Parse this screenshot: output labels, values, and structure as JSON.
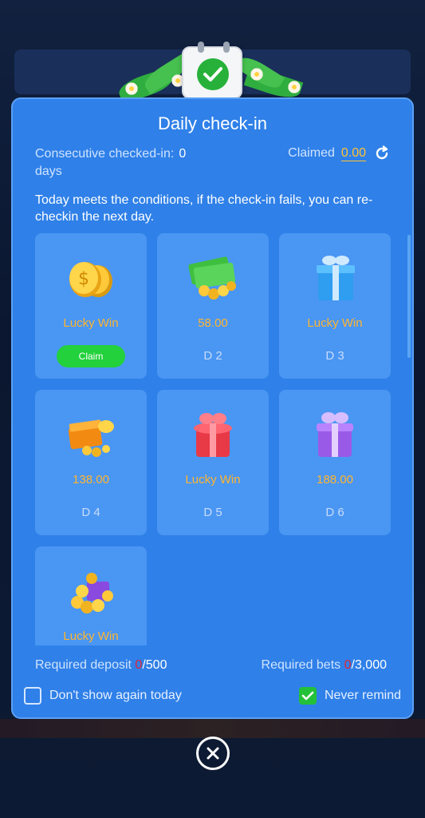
{
  "modal": {
    "title": "Daily check-in",
    "consecutive_label": "Consecutive checked-in:",
    "consecutive_value": "0",
    "consecutive_unit": "days",
    "claimed_label": "Claimed",
    "claimed_value": "0.00",
    "notice": "Today meets the conditions, if the check-in fails, you can re-checkin the next day."
  },
  "cards": [
    {
      "icon": "gold-coins-icon",
      "label": "Lucky Win",
      "day": "",
      "button": "Claim"
    },
    {
      "icon": "cash-and-coins-icon",
      "label": "58.00",
      "day": "D 2"
    },
    {
      "icon": "blue-gift-icon",
      "label": "Lucky Win",
      "day": "D 3"
    },
    {
      "icon": "orange-treasure-icon",
      "label": "138.00",
      "day": "D 4"
    },
    {
      "icon": "red-gift-icon",
      "label": "Lucky Win",
      "day": "D 5"
    },
    {
      "icon": "purple-gift-icon",
      "label": "188.00",
      "day": "D 6"
    },
    {
      "icon": "coin-pile-icon",
      "label": "Lucky Win",
      "day": ""
    }
  ],
  "requirements": {
    "deposit_label": "Required deposit",
    "deposit_current": "0",
    "deposit_total": "/500",
    "bets_label": "Required bets",
    "bets_current": "0",
    "bets_total": "/3,000"
  },
  "options": {
    "dont_show": "Don't show again today",
    "dont_show_checked": false,
    "never_remind": "Never remind",
    "never_remind_checked": true
  },
  "colors": {
    "modal_bg": "#2f80e8",
    "card_bg": "#4a96f3",
    "reward_text": "#ffb52e",
    "claim_button": "#23d13c",
    "required_current": "#e0263a"
  }
}
